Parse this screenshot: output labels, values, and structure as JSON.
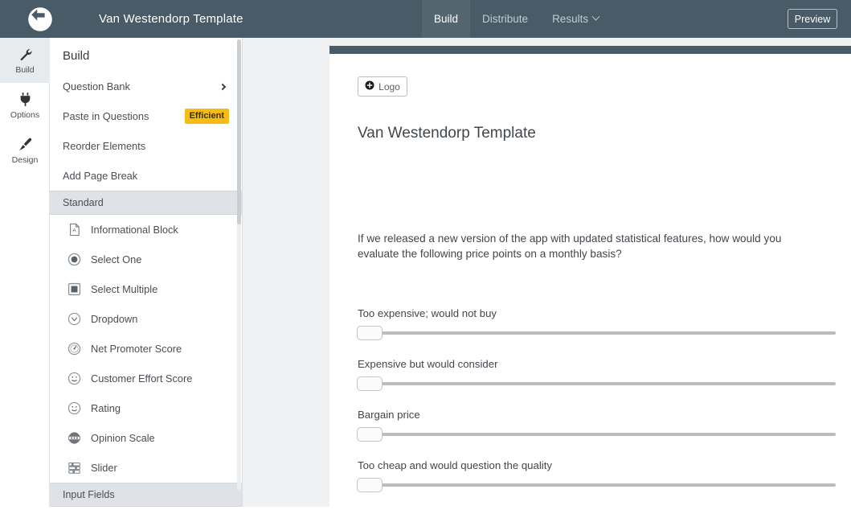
{
  "header": {
    "logo_icon": "qualtrics-circle-arrow-logo",
    "title": "Van Westendorp Template",
    "nav": [
      {
        "label": "Build",
        "active": true,
        "icon": null
      },
      {
        "label": "Distribute",
        "active": false,
        "icon": null
      },
      {
        "label": "Results",
        "active": false,
        "icon": "chevron-down-icon"
      }
    ],
    "preview_label": "Preview",
    "bar_color": "#485b66",
    "active_tab_color": "#53666f"
  },
  "rail": {
    "items": [
      {
        "label": "Build",
        "icon": "wrench-icon",
        "active": true
      },
      {
        "label": "Options",
        "icon": "plug-icon",
        "active": false
      },
      {
        "label": "Design",
        "icon": "paintbrush-icon",
        "active": false
      }
    ]
  },
  "panel": {
    "title": "Build",
    "actions": [
      {
        "label": "Question Bank",
        "trailing": "chevron-right-icon",
        "badge": null
      },
      {
        "label": "Paste in Questions",
        "trailing": null,
        "badge": "Efficient"
      },
      {
        "label": "Reorder Elements",
        "trailing": null,
        "badge": null
      },
      {
        "label": "Add Page Break",
        "trailing": null,
        "badge": null
      }
    ],
    "badge_color": "#f6bc16",
    "sections": [
      {
        "label": "Standard",
        "items": [
          {
            "label": "Informational Block",
            "icon": "document-a-icon"
          },
          {
            "label": "Select One",
            "icon": "radio-button-icon"
          },
          {
            "label": "Select Multiple",
            "icon": "checkbox-icon"
          },
          {
            "label": "Dropdown",
            "icon": "dropdown-chevron-circle-icon"
          },
          {
            "label": "Net Promoter Score",
            "icon": "gauge-icon"
          },
          {
            "label": "Customer Effort Score",
            "icon": "smiley-face-icon"
          },
          {
            "label": "Rating",
            "icon": "smiley-face-icon"
          },
          {
            "label": "Opinion Scale",
            "icon": "opinion-scale-icon"
          },
          {
            "label": "Slider",
            "icon": "slider-icon"
          }
        ]
      },
      {
        "label": "Input Fields",
        "items": []
      }
    ]
  },
  "canvas": {
    "logo_button_label": "Logo",
    "logo_button_icon": "plus-circle-icon",
    "survey_title": "Van Westendorp Template",
    "question_text": "If we released a new version of the app with updated statistical features, how would you evaluate the following price points on a monthly basis?",
    "sliders": [
      {
        "label": "Too expensive; would not buy",
        "value": 0
      },
      {
        "label": "Expensive but would consider",
        "value": 0
      },
      {
        "label": "Bargain price",
        "value": 0
      },
      {
        "label": "Too cheap and would question the quality",
        "value": 0
      }
    ]
  }
}
